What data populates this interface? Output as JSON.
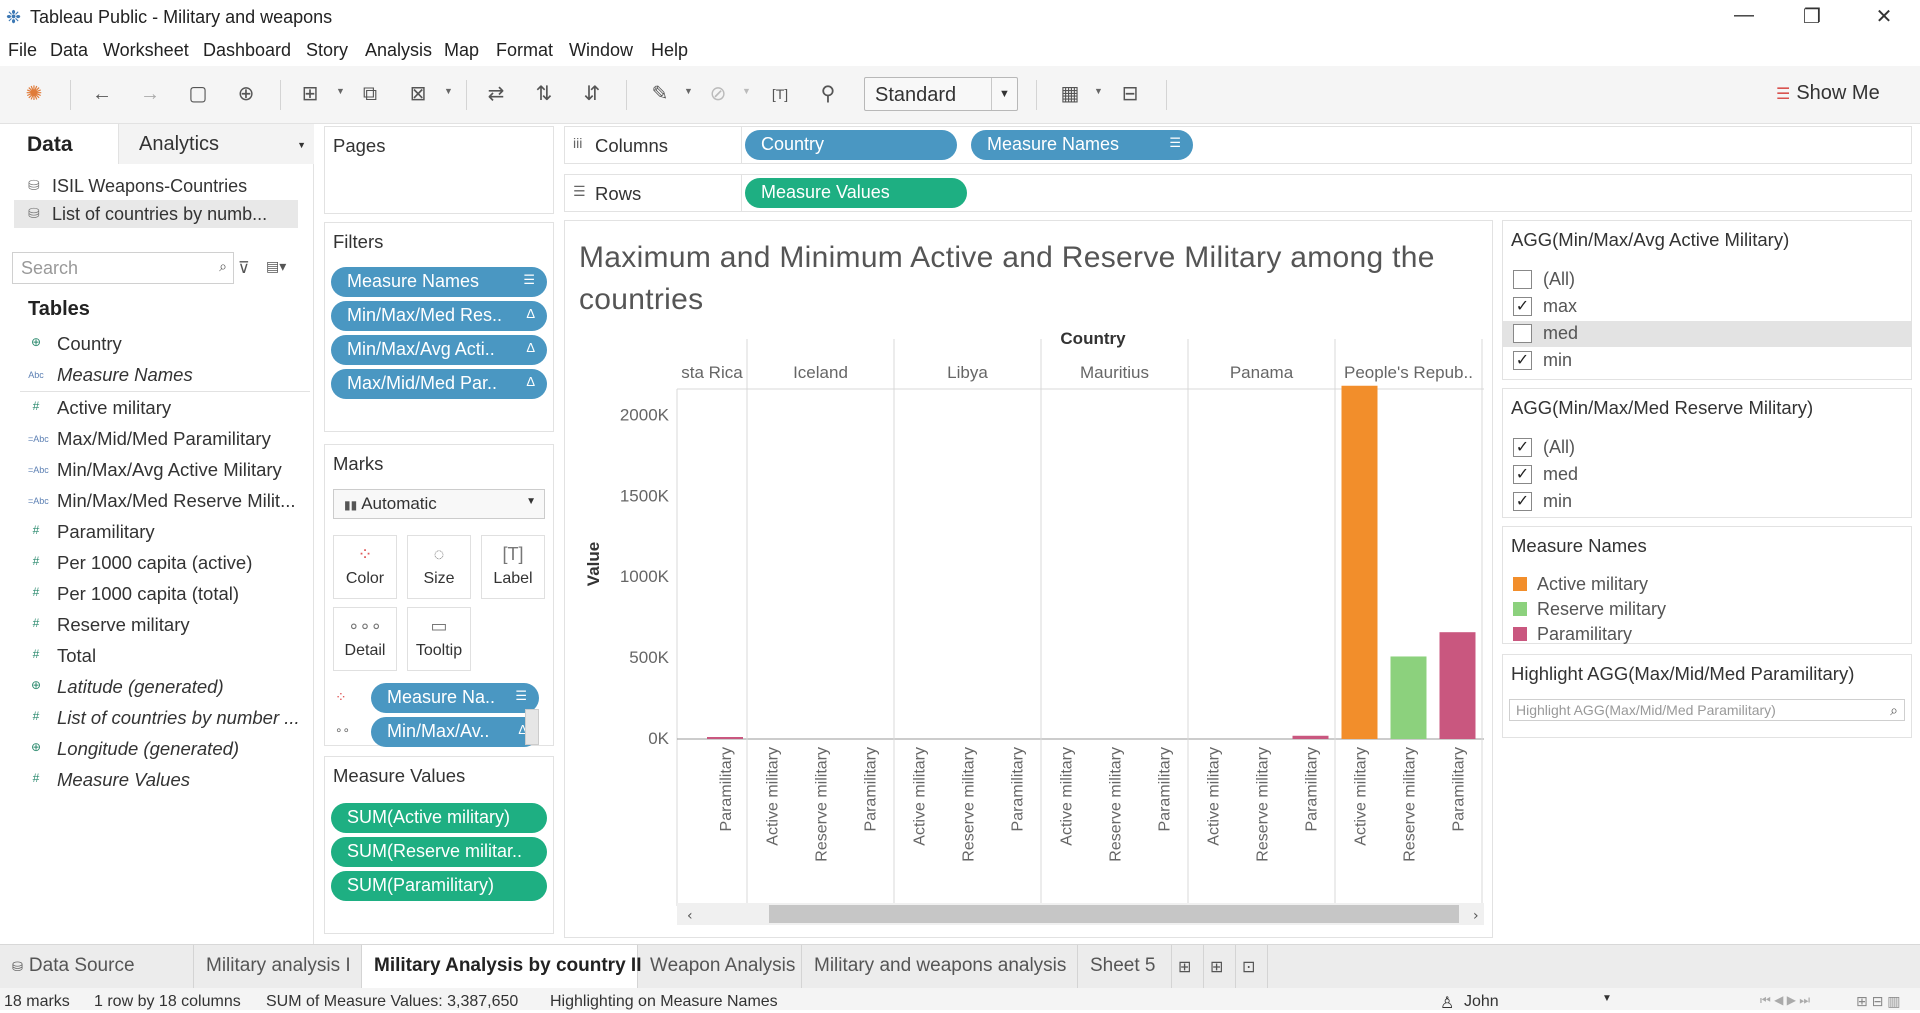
{
  "window": {
    "title": "Tableau Public - Military and weapons",
    "controls": {
      "minimize": "—",
      "restore": "❐",
      "close": "✕"
    }
  },
  "menu": [
    "File",
    "Data",
    "Worksheet",
    "Dashboard",
    "Story",
    "Analysis",
    "Map",
    "Format",
    "Window",
    "Help"
  ],
  "toolbar": {
    "fit_mode": "Standard",
    "show_me": "Show Me"
  },
  "data_pane": {
    "tabs": {
      "data": "Data",
      "analytics": "Analytics"
    },
    "datasources": [
      "ISIL Weapons-Countries",
      "List of countries by numb..."
    ],
    "search_placeholder": "Search",
    "tables_heading": "Tables",
    "fields": [
      {
        "name": "Country",
        "icon": "globe-icon",
        "italic": false
      },
      {
        "name": "Measure Names",
        "icon": "abc-icon",
        "italic": true
      },
      {
        "name": "Active military",
        "icon": "number-icon",
        "italic": false
      },
      {
        "name": "Max/Mid/Med Paramilitary",
        "icon": "calc-abc-icon",
        "italic": false
      },
      {
        "name": "Min/Max/Avg Active Military",
        "icon": "calc-abc-icon",
        "italic": false
      },
      {
        "name": "Min/Max/Med Reserve Milit...",
        "icon": "calc-abc-icon",
        "italic": false
      },
      {
        "name": "Paramilitary",
        "icon": "number-icon",
        "italic": false
      },
      {
        "name": "Per 1000 capita (active)",
        "icon": "number-icon",
        "italic": false
      },
      {
        "name": "Per 1000 capita (total)",
        "icon": "number-icon",
        "italic": false
      },
      {
        "name": "Reserve military",
        "icon": "number-icon",
        "italic": false
      },
      {
        "name": "Total",
        "icon": "number-icon",
        "italic": false
      },
      {
        "name": "Latitude (generated)",
        "icon": "globe-icon",
        "italic": true
      },
      {
        "name": "List of countries by number ...",
        "icon": "number-icon",
        "italic": true
      },
      {
        "name": "Longitude (generated)",
        "icon": "globe-icon",
        "italic": true
      },
      {
        "name": "Measure Values",
        "icon": "number-icon",
        "italic": true
      }
    ]
  },
  "pages": {
    "heading": "Pages"
  },
  "filters": {
    "heading": "Filters",
    "pills": [
      "Measure Names",
      "Min/Max/Med Res..",
      "Min/Max/Avg Acti..",
      "Max/Mid/Med Par.."
    ]
  },
  "marks": {
    "heading": "Marks",
    "type": "Automatic",
    "buttons": [
      "Color",
      "Size",
      "Label",
      "Detail",
      "Tooltip"
    ],
    "pills": [
      "Measure Na..",
      "Min/Max/Av.."
    ]
  },
  "measure_values": {
    "heading": "Measure Values",
    "pills": [
      "SUM(Active military)",
      "SUM(Reserve militar..",
      "SUM(Paramilitary)"
    ]
  },
  "shelves": {
    "columns_label": "Columns",
    "rows_label": "Rows",
    "columns": [
      "Country",
      "Measure Names"
    ],
    "rows": [
      "Measure Values"
    ]
  },
  "view": {
    "title": "Maximum and Minimum Active and Reserve Military among the countries",
    "header_title": "Country"
  },
  "chart_data": {
    "type": "bar",
    "xlabel": "Country",
    "ylabel": "Value",
    "ylim": [
      0,
      2200000
    ],
    "y_ticks": [
      "0K",
      "500K",
      "1000K",
      "1500K",
      "2000K"
    ],
    "y_tick_values": [
      0,
      500000,
      1000000,
      1500000,
      2000000
    ],
    "colors": {
      "Active military": "#f28e2b",
      "Reserve military": "#8cd17d",
      "Paramilitary": "#c9577f"
    },
    "countries": [
      {
        "name": "sta Rica",
        "bars": [
          {
            "measure": "Paramilitary",
            "value": 10000
          }
        ]
      },
      {
        "name": "Iceland",
        "bars": [
          {
            "measure": "Active military",
            "value": 0
          },
          {
            "measure": "Reserve military",
            "value": 0
          },
          {
            "measure": "Paramilitary",
            "value": 0
          }
        ]
      },
      {
        "name": "Libya",
        "bars": [
          {
            "measure": "Active military",
            "value": 0
          },
          {
            "measure": "Reserve military",
            "value": 0
          },
          {
            "measure": "Paramilitary",
            "value": 0
          }
        ]
      },
      {
        "name": "Mauritius",
        "bars": [
          {
            "measure": "Active military",
            "value": 0
          },
          {
            "measure": "Reserve military",
            "value": 0
          },
          {
            "measure": "Paramilitary",
            "value": 0
          }
        ]
      },
      {
        "name": "Panama",
        "bars": [
          {
            "measure": "Active military",
            "value": 0
          },
          {
            "measure": "Reserve military",
            "value": 0
          },
          {
            "measure": "Paramilitary",
            "value": 20000
          }
        ]
      },
      {
        "name": "People's Repub..",
        "bars": [
          {
            "measure": "Active military",
            "value": 2183000
          },
          {
            "measure": "Reserve military",
            "value": 510000
          },
          {
            "measure": "Paramilitary",
            "value": 660000
          }
        ]
      }
    ]
  },
  "right_panel": {
    "active_filter": {
      "title": "AGG(Min/Max/Avg Active Military)",
      "items": [
        {
          "label": "(All)",
          "checked": false
        },
        {
          "label": "max",
          "checked": true
        },
        {
          "label": "med",
          "checked": false
        },
        {
          "label": "min",
          "checked": true
        }
      ]
    },
    "reserve_filter": {
      "title": "AGG(Min/Max/Med Reserve Military)",
      "items": [
        {
          "label": "(All)",
          "checked": true
        },
        {
          "label": "med",
          "checked": true
        },
        {
          "label": "min",
          "checked": true
        }
      ]
    },
    "legend": {
      "title": "Measure Names",
      "items": [
        {
          "label": "Active military",
          "color": "#f28e2b"
        },
        {
          "label": "Reserve military",
          "color": "#8cd17d"
        },
        {
          "label": "Paramilitary",
          "color": "#c9577f"
        }
      ]
    },
    "highlighter": {
      "title": "Highlight AGG(Max/Mid/Med Paramilitary)",
      "placeholder": "Highlight AGG(Max/Mid/Med Paramilitary)"
    }
  },
  "sheet_tabs": {
    "data_source": "Data Source",
    "sheets": [
      "Military analysis I",
      "Military Analysis by country II",
      "Weapon Analysis",
      "Military and weapons analysis",
      "Sheet 5"
    ],
    "active": "Military Analysis by country II"
  },
  "status": {
    "marks": "18 marks",
    "rows_cols": "1 row by 18 columns",
    "sum": "SUM of Measure Values: 3,387,650",
    "highlight": "Highlighting on Measure Names",
    "user": "John"
  }
}
